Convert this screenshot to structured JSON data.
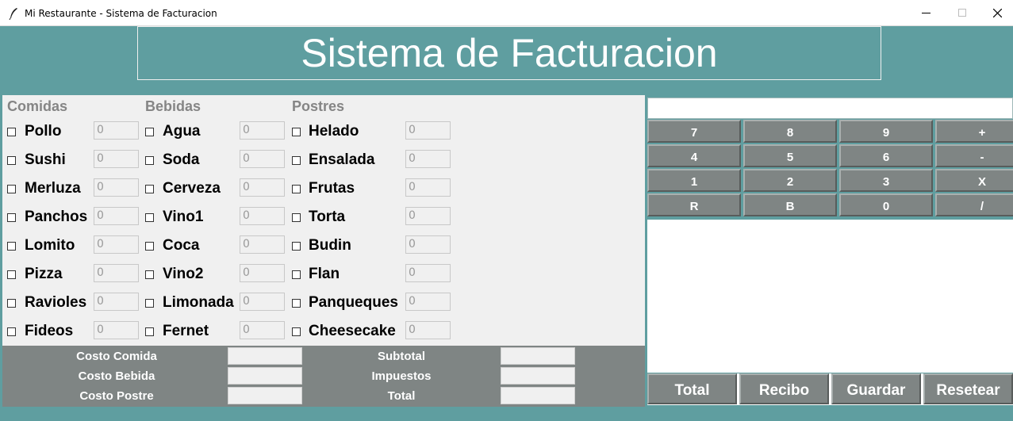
{
  "window": {
    "title": "Mi Restaurante - Sistema de Facturacion",
    "minimize_glyph": "—",
    "close_glyph": "✕"
  },
  "header": {
    "title": "Sistema de Facturacion"
  },
  "menu": {
    "comidas": {
      "title": "Comidas",
      "items": [
        {
          "label": "Pollo",
          "qty": "0"
        },
        {
          "label": "Sushi",
          "qty": "0"
        },
        {
          "label": "Merluza",
          "qty": "0"
        },
        {
          "label": "Panchos",
          "qty": "0"
        },
        {
          "label": "Lomito",
          "qty": "0"
        },
        {
          "label": "Pizza",
          "qty": "0"
        },
        {
          "label": "Ravioles",
          "qty": "0"
        },
        {
          "label": "Fideos",
          "qty": "0"
        }
      ]
    },
    "bebidas": {
      "title": "Bebidas",
      "items": [
        {
          "label": "Agua",
          "qty": "0"
        },
        {
          "label": "Soda",
          "qty": "0"
        },
        {
          "label": "Cerveza",
          "qty": "0"
        },
        {
          "label": "Vino1",
          "qty": "0"
        },
        {
          "label": "Coca",
          "qty": "0"
        },
        {
          "label": "Vino2",
          "qty": "0"
        },
        {
          "label": "Limonada",
          "qty": "0"
        },
        {
          "label": "Fernet",
          "qty": "0"
        }
      ]
    },
    "postres": {
      "title": "Postres",
      "items": [
        {
          "label": "Helado",
          "qty": "0"
        },
        {
          "label": "Ensalada",
          "qty": "0"
        },
        {
          "label": "Frutas",
          "qty": "0"
        },
        {
          "label": "Torta",
          "qty": "0"
        },
        {
          "label": "Budin",
          "qty": "0"
        },
        {
          "label": "Flan",
          "qty": "0"
        },
        {
          "label": "Panqueques",
          "qty": "0"
        },
        {
          "label": "Cheesecake",
          "qty": "0"
        }
      ]
    }
  },
  "costs": {
    "costo_comida": "Costo Comida",
    "costo_bebida": "Costo Bebida",
    "costo_postre": "Costo Postre",
    "subtotal": "Subtotal",
    "impuestos": "Impuestos",
    "total": "Total"
  },
  "calculator": {
    "display": "",
    "keys": [
      "7",
      "8",
      "9",
      "+",
      "4",
      "5",
      "6",
      "-",
      "1",
      "2",
      "3",
      "X",
      "R",
      "B",
      "0",
      "/"
    ]
  },
  "actions": [
    "Total",
    "Recibo",
    "Guardar",
    "Resetear"
  ],
  "colors": {
    "background": "#5f9ea0",
    "panel": "#f0f0f0",
    "button": "#7f8584",
    "category_title": "#858585"
  }
}
